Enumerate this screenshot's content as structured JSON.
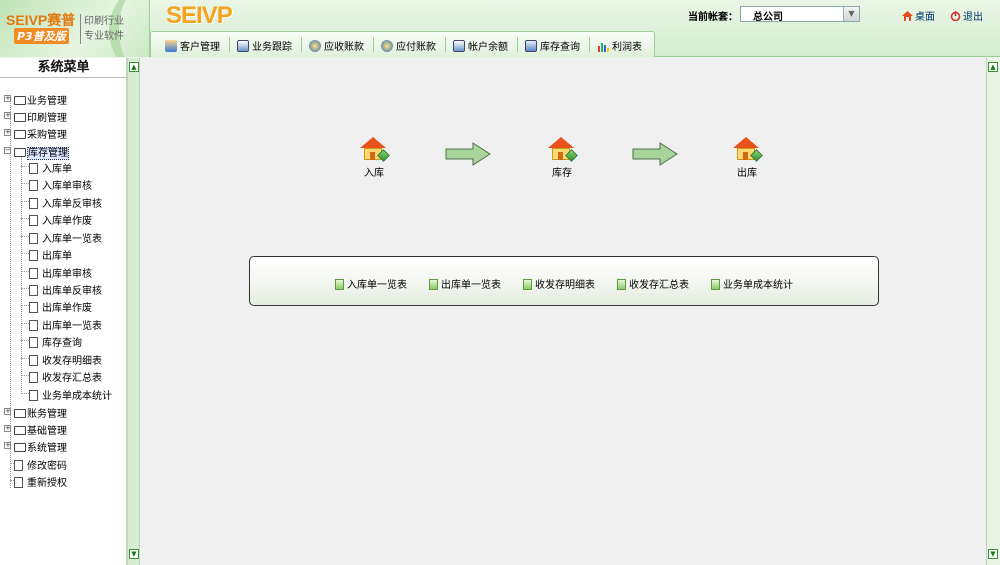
{
  "colors": {
    "brand_orange": "#f7a21d",
    "header_green": "#d5ecd0",
    "border_green": "#9ccf95",
    "roof_red": "#e8511b",
    "arrow_green": "#9fcf93"
  },
  "header": {
    "logo": {
      "brand": "SEIVP赛普",
      "edition": "P3普及版",
      "slogan_line1": "印刷行业",
      "slogan_line2": "专业软件"
    },
    "brand_title": "SEIVP",
    "account": {
      "label": "当前帐套：",
      "value": "总公司"
    },
    "desktop_label": "桌面",
    "logout_label": "退出"
  },
  "topnav": [
    {
      "label": "客户管理",
      "icon": "customer-icon"
    },
    {
      "label": "业务跟踪",
      "icon": "tracking-icon"
    },
    {
      "label": "应收账款",
      "icon": "receivable-icon"
    },
    {
      "label": "应付账款",
      "icon": "payable-icon"
    },
    {
      "label": "帐户余额",
      "icon": "balance-icon"
    },
    {
      "label": "库存查询",
      "icon": "inventory-icon"
    },
    {
      "label": "利润表",
      "icon": "profit-chart-icon"
    }
  ],
  "sidebar": {
    "title": "系统菜单",
    "groups": [
      {
        "label": "业务管理",
        "expanded": false
      },
      {
        "label": "印刷管理",
        "expanded": false
      },
      {
        "label": "采购管理",
        "expanded": false
      },
      {
        "label": "库存管理",
        "expanded": true,
        "selected": true,
        "children": [
          "入库单",
          "入库单审核",
          "入库单反审核",
          "入库单作废",
          "入库单一览表",
          "出库单",
          "出库单审核",
          "出库单反审核",
          "出库单作废",
          "出库单一览表",
          "库存查询",
          "收发存明细表",
          "收发存汇总表",
          "业务单成本统计"
        ]
      },
      {
        "label": "账务管理",
        "expanded": false
      },
      {
        "label": "基础管理",
        "expanded": false
      },
      {
        "label": "系统管理",
        "expanded": false
      }
    ],
    "leaf_items": [
      "修改密码",
      "重新授权"
    ]
  },
  "flow": {
    "nodes": [
      "入库",
      "库存",
      "出库"
    ]
  },
  "reports": [
    "入库单一览表",
    "出库单一览表",
    "收发存明细表",
    "收发存汇总表",
    "业务单成本统计"
  ]
}
